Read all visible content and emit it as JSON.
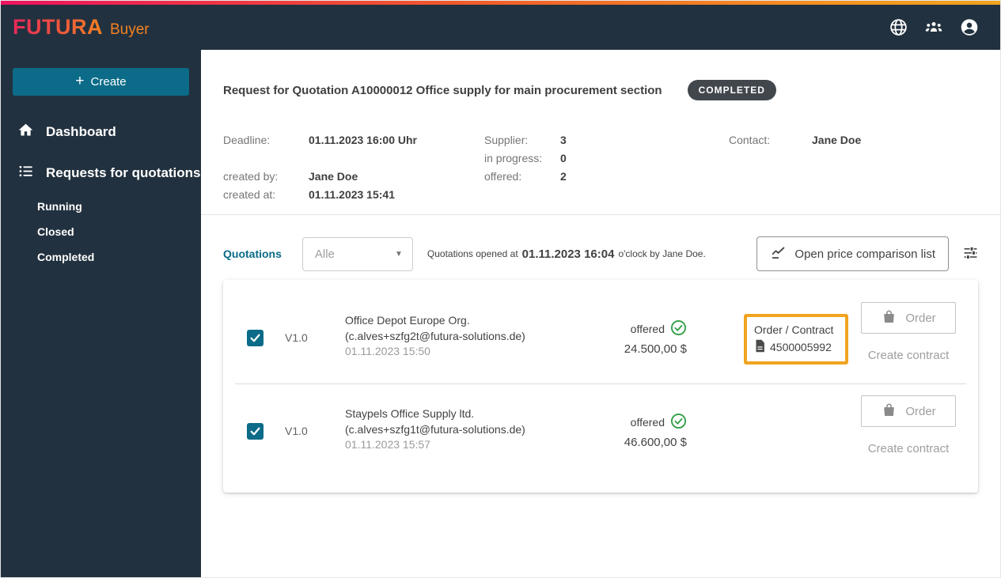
{
  "brand": {
    "name": "FUTURA",
    "product": "Buyer"
  },
  "topbar": {
    "icons": [
      "globe-icon",
      "team-icon",
      "account-icon"
    ]
  },
  "sidebar": {
    "create_plus": "+",
    "create_label": "Create",
    "items": [
      {
        "label": "Dashboard",
        "icon": "home-icon"
      },
      {
        "label": "Requests for quotations",
        "icon": "list-icon"
      }
    ],
    "sub_items": [
      "Running",
      "Closed",
      "Completed"
    ]
  },
  "header": {
    "title": "Request for Quotation A10000012 Office supply for main procurement section",
    "status_badge": "COMPLETED"
  },
  "details": {
    "deadline_label": "Deadline:",
    "deadline_value": "01.11.2023 16:00 Uhr",
    "created_by_label": "created by:",
    "created_by_value": "Jane Doe",
    "created_at_label": "created at:",
    "created_at_value": "01.11.2023 15:41",
    "supplier_label": "Supplier:",
    "supplier_value": "3",
    "in_progress_label": "in progress:",
    "in_progress_value": "0",
    "offered_label": "offered:",
    "offered_value": "2",
    "contact_label": "Contact:",
    "contact_value": "Jane Doe"
  },
  "quotations": {
    "section_label": "Quotations",
    "filter_value": "Alle",
    "opened_prefix": "Quotations opened at",
    "opened_time": "01.11.2023 16:04",
    "opened_suffix": "o'clock by Jane Doe.",
    "price_comparison_button": "Open price comparison list",
    "rows": [
      {
        "version": "V1.0",
        "checked": true,
        "supplier_name": "Office Depot Europe Org.",
        "supplier_email": "(c.alves+szfg2t@futura-solutions.de)",
        "submitted_at": "01.11.2023 15:50",
        "status": "offered",
        "price": "24.500,00 $",
        "order_contract_label": "Order / Contract",
        "order_contract_number": "4500005992",
        "order_button": "Order",
        "create_contract_label": "Create contract"
      },
      {
        "version": "V1.0",
        "checked": true,
        "supplier_name": "Staypels Office Supply ltd.",
        "supplier_email": "(c.alves+szfg1t@futura-solutions.de)",
        "submitted_at": "01.11.2023 15:57",
        "status": "offered",
        "price": "46.600,00 $",
        "order_button": "Order",
        "create_contract_label": "Create contract"
      }
    ]
  },
  "colors": {
    "navy": "#22313f",
    "teal": "#0b6b88",
    "orange_highlight": "#f0a41f",
    "success_green": "#2f9e44",
    "badge_gray": "#41474d",
    "gradient_start": "#ec135f",
    "gradient_end": "#f59120",
    "brand_orange": "#f58220"
  }
}
